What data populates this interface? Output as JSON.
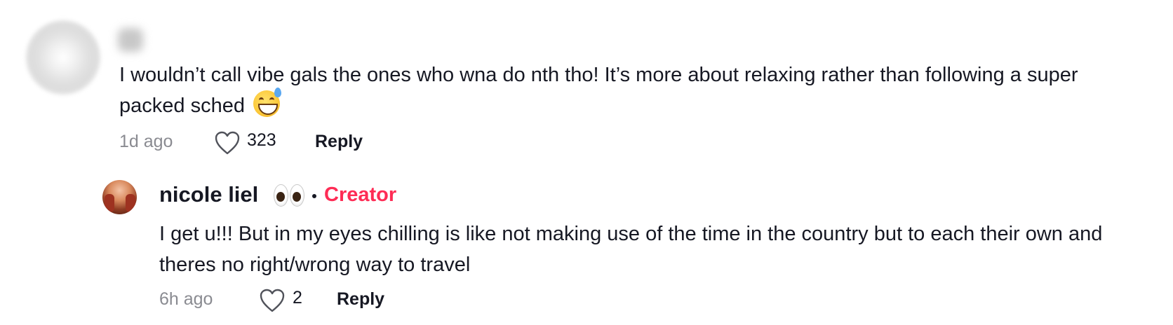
{
  "comments": [
    {
      "username": "",
      "text": "I wouldn’t call vibe gals the ones who wna do nth tho! It’s more about relaxing rather than following a super packed sched ",
      "emoji": "grinning-face-with-sweat",
      "time": "1d ago",
      "likes": "323",
      "reply_label": "Reply"
    },
    {
      "username": "nicole liel",
      "username_emoji": "eyes",
      "badge": "Creator",
      "text": "I get u!!! But in my eyes chilling is like not making use of the time in the country but to each their own and theres no right/wrong way to travel",
      "time": "6h ago",
      "likes": "2",
      "reply_label": "Reply"
    }
  ],
  "icons": {
    "like": "heart-outline-icon"
  },
  "colors": {
    "text": "#161823",
    "muted": "#8a8b91",
    "creator": "#fe2c55"
  }
}
